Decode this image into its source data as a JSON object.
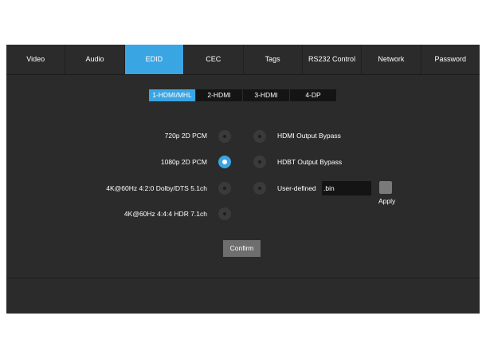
{
  "tabs": [
    {
      "label": "Video",
      "active": false
    },
    {
      "label": "Audio",
      "active": false
    },
    {
      "label": "EDID",
      "active": true
    },
    {
      "label": "CEC",
      "active": false
    },
    {
      "label": "Tags",
      "active": false
    },
    {
      "label": "RS232 Control",
      "active": false
    },
    {
      "label": "Network",
      "active": false
    },
    {
      "label": "Password",
      "active": false
    }
  ],
  "subtabs": [
    {
      "label": "1-HDMI/MHL",
      "active": true
    },
    {
      "label": "2-HDMI",
      "active": false
    },
    {
      "label": "3-HDMI",
      "active": false
    },
    {
      "label": "4-DP",
      "active": false
    }
  ],
  "edid_left": [
    {
      "label": "720p 2D PCM",
      "checked": false
    },
    {
      "label": "1080p 2D PCM",
      "checked": true
    },
    {
      "label": "4K@60Hz 4:2:0 Dolby/DTS 5.1ch",
      "checked": false
    },
    {
      "label": "4K@60Hz 4:4:4 HDR 7.1ch",
      "checked": false
    }
  ],
  "edid_right": [
    {
      "label": "HDMI Output Bypass",
      "checked": false
    },
    {
      "label": "HDBT Output Bypass",
      "checked": false
    },
    {
      "label": "User-defined",
      "checked": false
    }
  ],
  "user_defined": {
    "file_value": ".bin",
    "apply_label": "Apply"
  },
  "confirm_label": "Confirm",
  "colors": {
    "panel_bg": "#2b2b2b",
    "accent": "#3aa5e3",
    "field_bg": "#141414",
    "button_bg": "#6e6e6e"
  }
}
